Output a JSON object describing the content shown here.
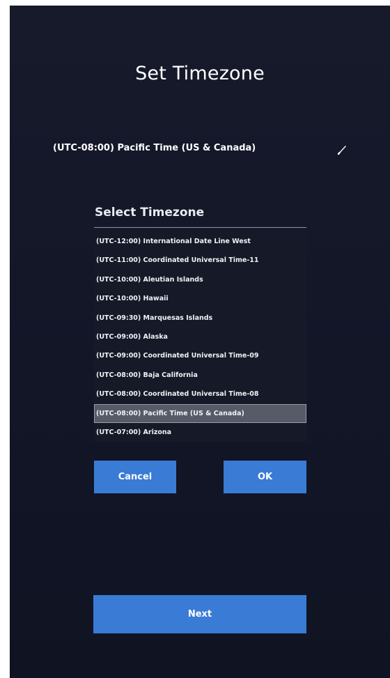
{
  "page": {
    "title": "Set Timezone",
    "current_timezone": "(UTC-08:00) Pacific Time (US & Canada)",
    "edit_icon": "pencil-icon"
  },
  "dialog": {
    "title": "Select Timezone",
    "selected_index": 9,
    "items": [
      "(UTC-12:00) International Date Line West",
      "(UTC-11:00) Coordinated Universal Time-11",
      "(UTC-10:00) Aleutian Islands",
      "(UTC-10:00) Hawaii",
      "(UTC-09:30) Marquesas Islands",
      "(UTC-09:00) Alaska",
      "(UTC-09:00) Coordinated Universal Time-09",
      "(UTC-08:00) Baja California",
      "(UTC-08:00) Coordinated Universal Time-08",
      "(UTC-08:00) Pacific Time (US & Canada)",
      "(UTC-07:00) Arizona"
    ],
    "cancel_label": "Cancel",
    "ok_label": "OK"
  },
  "footer": {
    "next_label": "Next"
  },
  "colors": {
    "background": "#141828",
    "accent": "#3a7bd5",
    "selected_row": "#575a67"
  }
}
